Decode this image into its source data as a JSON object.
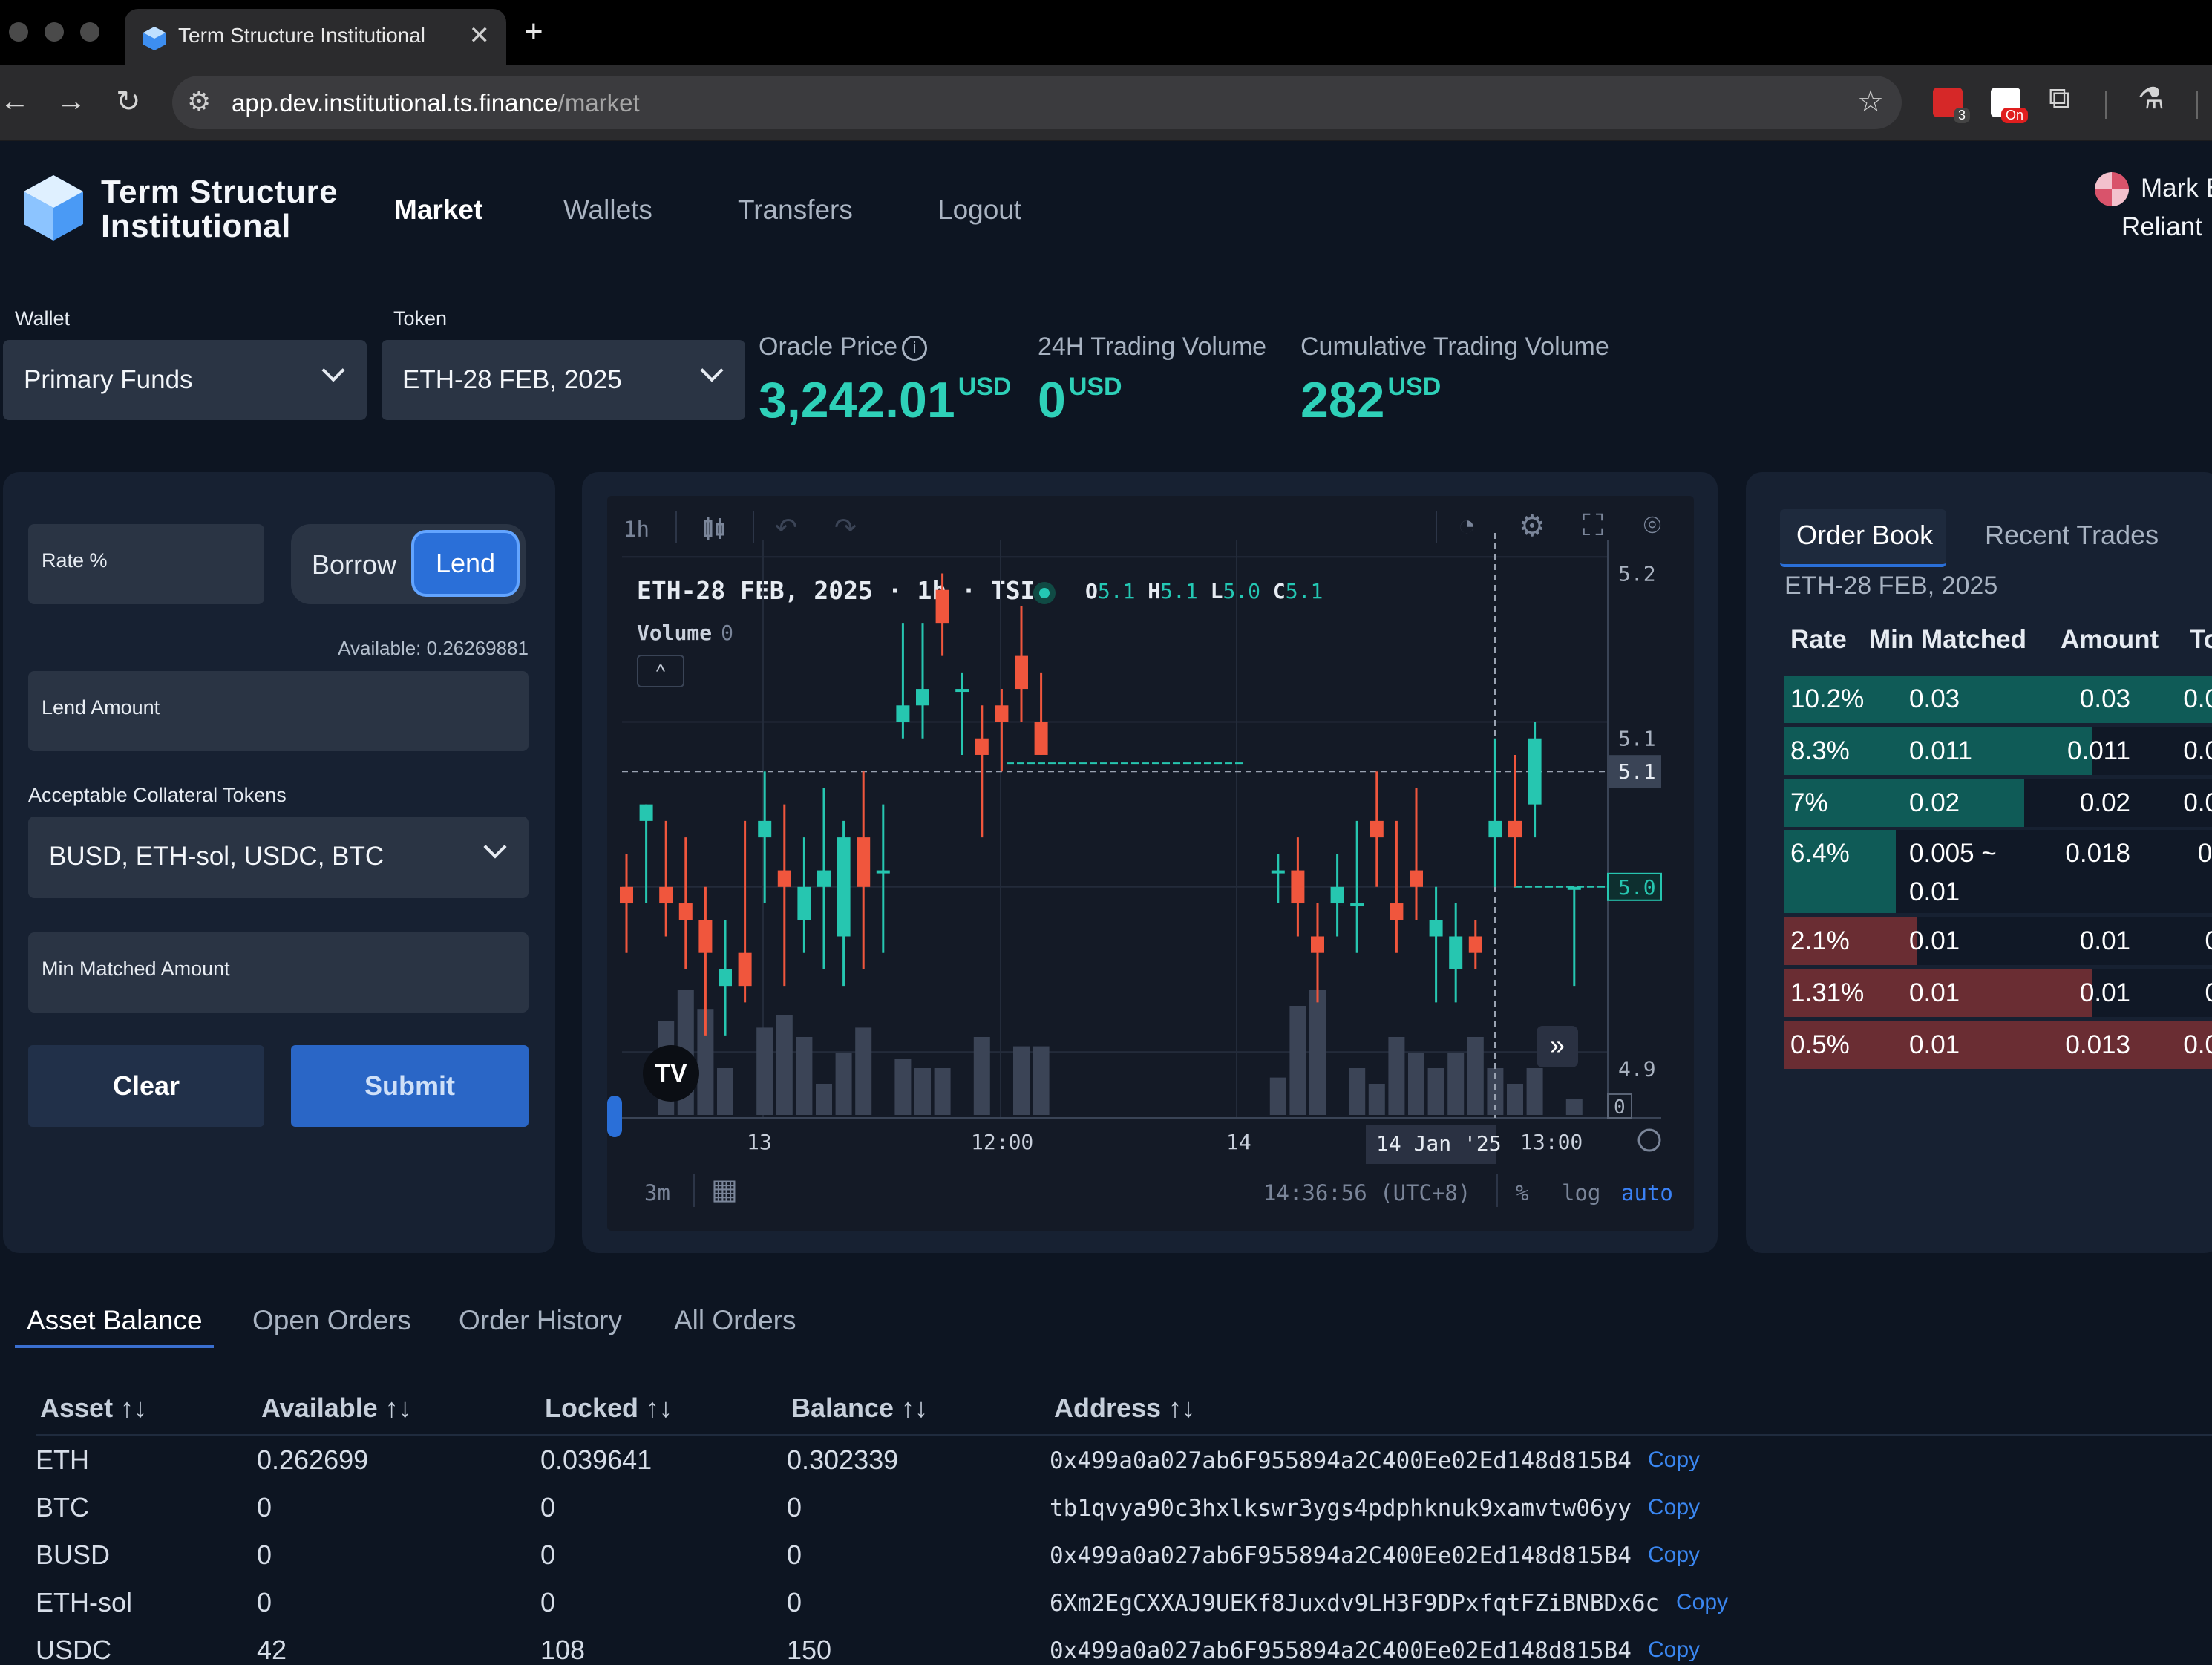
{
  "browser": {
    "tab_title": "Term Structure Institutional",
    "tab_close": "✕",
    "new_tab": "+",
    "url_host": "app.dev.institutional.ts.finance",
    "url_path": "/market",
    "ext_badge_1": "3",
    "ext_badge_2": "On"
  },
  "app": {
    "brand_line1": "Term Structure",
    "brand_line2": "Institutional",
    "nav": [
      "Market",
      "Wallets",
      "Transfers",
      "Logout"
    ],
    "user_name": "Mark B",
    "user_org": "Reliant"
  },
  "selectors": {
    "wallet_label": "Wallet",
    "wallet_value": "Primary Funds",
    "token_label": "Token",
    "token_value": "ETH-28 FEB, 2025"
  },
  "stats": {
    "oracle_label": "Oracle Price",
    "oracle_info": "i",
    "oracle_value": "3,242.01",
    "oracle_unit": "USD",
    "vol24_label": "24H Trading Volume",
    "vol24_value": "0",
    "vol24_unit": "USD",
    "cum_label": "Cumulative Trading Volume",
    "cum_value": "282",
    "cum_unit": "USD"
  },
  "order_form": {
    "rate_placeholder": "Rate %",
    "borrow_label": "Borrow",
    "lend_label": "Lend",
    "available": "Available: 0.26269881",
    "amount_placeholder": "Lend Amount",
    "collateral_label": "Acceptable Collateral Tokens",
    "collateral_value": "BUSD, ETH-sol, USDC, BTC",
    "min_matched_placeholder": "Min Matched Amount",
    "clear_label": "Clear",
    "submit_label": "Submit"
  },
  "chart": {
    "interval": "1h",
    "title": "ETH-28 FEB, 2025 · 1h · TSI",
    "o_label": "O",
    "o_val": "5.1",
    "h_label": "H",
    "h_val": "5.1",
    "l_label": "L",
    "l_val": "5.0",
    "c_label": "C",
    "c_val": "5.1",
    "volume_label": "Volume",
    "volume_val": "0",
    "collapse": "^",
    "tv_logo": "TV",
    "scroll_right": "»",
    "range": "3m",
    "time": "14:36:56 (UTC+8)",
    "pct": "%",
    "log": "log",
    "auto": "auto",
    "colors": {
      "up": "#26c6b0",
      "down": "#f0563d"
    }
  },
  "chart_data": {
    "type": "candlestick",
    "y_ticks": [
      "5.2",
      "5.1",
      "4.9"
    ],
    "price_labels": [
      "5.1",
      "5.0"
    ],
    "volume_tick": "0",
    "x_ticks": [
      "13",
      "12:00",
      "14",
      "13:00"
    ],
    "crosshair_date": "14 Jan '25",
    "ylim": [
      4.86,
      5.21
    ],
    "candles": [
      {
        "x": 0,
        "o": 5.0,
        "h": 5.02,
        "l": 4.96,
        "c": 4.99,
        "vol": 0
      },
      {
        "x": 1,
        "o": 5.04,
        "h": 5.05,
        "l": 4.99,
        "c": 5.05,
        "vol": 0
      },
      {
        "x": 2,
        "o": 5.0,
        "h": 5.04,
        "l": 4.97,
        "c": 4.99,
        "vol": 30
      },
      {
        "x": 3,
        "o": 4.99,
        "h": 5.03,
        "l": 4.95,
        "c": 4.98,
        "vol": 40
      },
      {
        "x": 4,
        "o": 4.98,
        "h": 5.0,
        "l": 4.91,
        "c": 4.96,
        "vol": 34
      },
      {
        "x": 5,
        "o": 4.94,
        "h": 4.98,
        "l": 4.91,
        "c": 4.95,
        "vol": 15
      },
      {
        "x": 6,
        "o": 4.96,
        "h": 5.04,
        "l": 4.93,
        "c": 4.94,
        "vol": 0
      },
      {
        "x": 7,
        "o": 5.03,
        "h": 5.07,
        "l": 4.99,
        "c": 5.04,
        "vol": 28
      },
      {
        "x": 8,
        "o": 5.01,
        "h": 5.05,
        "l": 4.94,
        "c": 5.0,
        "vol": 32
      },
      {
        "x": 9,
        "o": 4.98,
        "h": 5.03,
        "l": 4.96,
        "c": 5.0,
        "vol": 25
      },
      {
        "x": 10,
        "o": 5.0,
        "h": 5.06,
        "l": 4.95,
        "c": 5.01,
        "vol": 10
      },
      {
        "x": 11,
        "o": 4.97,
        "h": 5.04,
        "l": 4.94,
        "c": 5.03,
        "vol": 20
      },
      {
        "x": 12,
        "o": 5.03,
        "h": 5.07,
        "l": 4.95,
        "c": 5.0,
        "vol": 28
      },
      {
        "x": 13,
        "o": 5.01,
        "h": 5.05,
        "l": 4.96,
        "c": 5.01,
        "vol": 0
      },
      {
        "x": 14,
        "o": 5.1,
        "h": 5.16,
        "l": 5.09,
        "c": 5.11,
        "vol": 18
      },
      {
        "x": 15,
        "o": 5.11,
        "h": 5.16,
        "l": 5.09,
        "c": 5.12,
        "vol": 15
      },
      {
        "x": 16,
        "o": 5.18,
        "h": 5.19,
        "l": 5.14,
        "c": 5.16,
        "vol": 15
      },
      {
        "x": 17,
        "o": 5.12,
        "h": 5.13,
        "l": 5.08,
        "c": 5.12,
        "vol": 0
      },
      {
        "x": 18,
        "o": 5.09,
        "h": 5.11,
        "l": 5.03,
        "c": 5.08,
        "vol": 25
      },
      {
        "x": 19,
        "o": 5.11,
        "h": 5.12,
        "l": 5.07,
        "c": 5.1,
        "vol": 0
      },
      {
        "x": 20,
        "o": 5.14,
        "h": 5.17,
        "l": 5.1,
        "c": 5.12,
        "vol": 22
      },
      {
        "x": 21,
        "o": 5.1,
        "h": 5.13,
        "l": 5.08,
        "c": 5.08,
        "vol": 22
      },
      {
        "x": 33,
        "o": 5.01,
        "h": 5.02,
        "l": 4.99,
        "c": 5.01,
        "vol": 12
      },
      {
        "x": 34,
        "o": 5.01,
        "h": 5.03,
        "l": 4.97,
        "c": 4.99,
        "vol": 35
      },
      {
        "x": 35,
        "o": 4.97,
        "h": 4.99,
        "l": 4.93,
        "c": 4.96,
        "vol": 40
      },
      {
        "x": 36,
        "o": 4.99,
        "h": 5.02,
        "l": 4.97,
        "c": 5.0,
        "vol": 0
      },
      {
        "x": 37,
        "o": 4.99,
        "h": 5.04,
        "l": 4.96,
        "c": 4.99,
        "vol": 15
      },
      {
        "x": 38,
        "o": 5.04,
        "h": 5.07,
        "l": 5.0,
        "c": 5.03,
        "vol": 10
      },
      {
        "x": 39,
        "o": 4.99,
        "h": 5.04,
        "l": 4.96,
        "c": 4.98,
        "vol": 25
      },
      {
        "x": 40,
        "o": 5.01,
        "h": 5.06,
        "l": 4.98,
        "c": 5.0,
        "vol": 20
      },
      {
        "x": 41,
        "o": 4.97,
        "h": 5.0,
        "l": 4.93,
        "c": 4.98,
        "vol": 15
      },
      {
        "x": 42,
        "o": 4.95,
        "h": 4.99,
        "l": 4.93,
        "c": 4.97,
        "vol": 20
      },
      {
        "x": 43,
        "o": 4.97,
        "h": 4.98,
        "l": 4.95,
        "c": 4.96,
        "vol": 25
      },
      {
        "x": 44,
        "o": 5.03,
        "h": 5.09,
        "l": 5.0,
        "c": 5.04,
        "vol": 15
      },
      {
        "x": 45,
        "o": 5.04,
        "h": 5.08,
        "l": 5.0,
        "c": 5.03,
        "vol": 10
      },
      {
        "x": 46,
        "o": 5.05,
        "h": 5.1,
        "l": 5.03,
        "c": 5.09,
        "vol": 15
      },
      {
        "x": 48,
        "o": 5.0,
        "h": 5.0,
        "l": 4.94,
        "c": 5.0,
        "vol": 5
      }
    ]
  },
  "order_book": {
    "tabs": [
      "Order Book",
      "Recent Trades"
    ],
    "subtitle": "ETH-28 FEB, 2025",
    "headers": [
      "Rate",
      "Min Matched",
      "Amount",
      "To"
    ],
    "rows": [
      {
        "rate": "10.2%",
        "min": "0.03",
        "min2": "",
        "amount": "0.03",
        "total": "0.0",
        "side": "bid",
        "fill": 1.0
      },
      {
        "rate": "8.3%",
        "min": "0.011",
        "min2": "",
        "amount": "0.011",
        "total": "0.0",
        "side": "bid",
        "fill": 0.72
      },
      {
        "rate": "7%",
        "min": "0.02",
        "min2": "",
        "amount": "0.02",
        "total": "0.0",
        "side": "bid",
        "fill": 0.56
      },
      {
        "rate": "6.4%",
        "min": "0.005 ~",
        "min2": "0.01",
        "amount": "0.018",
        "total": "0.",
        "side": "bid",
        "fill": 0.26
      },
      {
        "rate": "2.1%",
        "min": "0.01",
        "min2": "",
        "amount": "0.01",
        "total": "0",
        "side": "ask",
        "fill": 0.31
      },
      {
        "rate": "1.31%",
        "min": "0.01",
        "min2": "",
        "amount": "0.01",
        "total": "0",
        "side": "ask",
        "fill": 0.72
      },
      {
        "rate": "0.5%",
        "min": "0.01",
        "min2": "",
        "amount": "0.013",
        "total": "0.0",
        "side": "ask",
        "fill": 1.0
      }
    ]
  },
  "balances": {
    "tabs": [
      "Asset Balance",
      "Open Orders",
      "Order History",
      "All Orders"
    ],
    "headers": [
      "Asset",
      "Available",
      "Locked",
      "Balance",
      "Address"
    ],
    "sort_icon": "↑↓",
    "copy_label": "Copy",
    "rows": [
      {
        "asset": "ETH",
        "available": "0.262699",
        "locked": "0.039641",
        "balance": "0.302339",
        "address": "0x499a0a027ab6F955894a2C400Ee02Ed148d815B4"
      },
      {
        "asset": "BTC",
        "available": "0",
        "locked": "0",
        "balance": "0",
        "address": "tb1qvya90c3hxlkswr3ygs4pdphknuk9xamvtw06yy"
      },
      {
        "asset": "BUSD",
        "available": "0",
        "locked": "0",
        "balance": "0",
        "address": "0x499a0a027ab6F955894a2C400Ee02Ed148d815B4"
      },
      {
        "asset": "ETH-sol",
        "available": "0",
        "locked": "0",
        "balance": "0",
        "address": "6Xm2EgCXXAJ9UEKf8Juxdv9LH3F9DPxfqtFZiBNBDx6c"
      },
      {
        "asset": "USDC",
        "available": "42",
        "locked": "108",
        "balance": "150",
        "address": "0x499a0a027ab6F955894a2C400Ee02Ed148d815B4"
      }
    ]
  },
  "colors": {
    "accent": "#2a6fd8",
    "teal": "#2ed0b8",
    "bid_bar": "#0f5b57",
    "ask_bar": "#6a2d33",
    "bg": "#0d1522",
    "panel": "#172132"
  }
}
